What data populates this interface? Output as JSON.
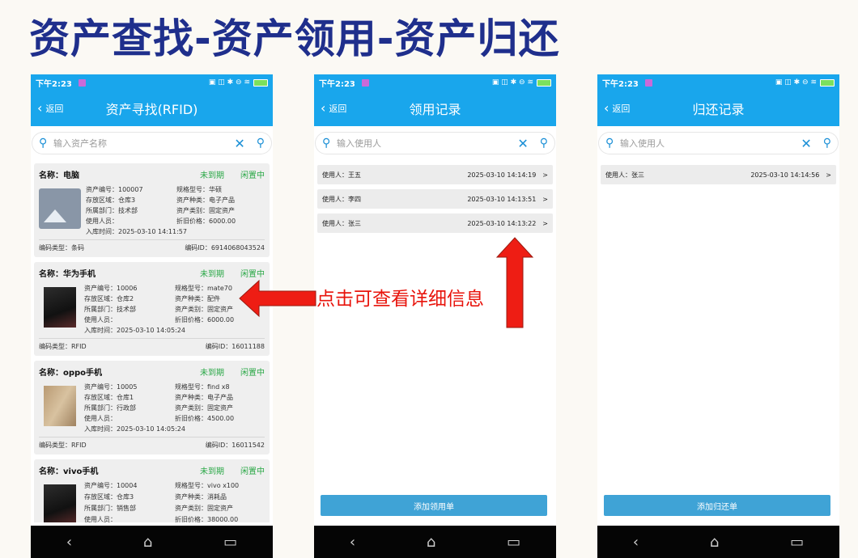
{
  "page_title": "资产查找-资产领用-资产归还",
  "annotation": "点击可查看详细信息",
  "status": {
    "time": "下午2:23"
  },
  "back_label": "返回",
  "screen1": {
    "title": "资产寻找(RFID)",
    "search_placeholder": "输入资产名称",
    "cards": [
      {
        "name": "名称：电脑",
        "status1": "未到期",
        "status2": "闲置中",
        "f1a": "资产编号：100007",
        "f1b": "规格型号：华硕",
        "f2a": "存放区域：仓库3",
        "f2b": "资产种类：电子产品",
        "f3a": "所属部门：技术部",
        "f3b": "资产类别：固定资产",
        "f4a": "使用人员：",
        "f4b": "折旧价格：6000.00",
        "f5a": "入库时间：2025-03-10 14:11:57",
        "code_type": "编码类型：条码",
        "code_id": "编码ID：6914068043524"
      },
      {
        "name": "名称：华为手机",
        "status1": "未到期",
        "status2": "闲置中",
        "f1a": "资产编号：10006",
        "f1b": "规格型号：mate70",
        "f2a": "存放区域：仓库2",
        "f2b": "资产种类：配件",
        "f3a": "所属部门：技术部",
        "f3b": "资产类别：固定资产",
        "f4a": "使用人员：",
        "f4b": "折旧价格：6000.00",
        "f5a": "入库时间：2025-03-10 14:05:24",
        "code_type": "编码类型：RFID",
        "code_id": "编码ID：16011188"
      },
      {
        "name": "名称：oppo手机",
        "status1": "未到期",
        "status2": "闲置中",
        "f1a": "资产编号：10005",
        "f1b": "规格型号：find x8",
        "f2a": "存放区域：仓库1",
        "f2b": "资产种类：电子产品",
        "f3a": "所属部门：行政部",
        "f3b": "资产类别：固定资产",
        "f4a": "使用人员：",
        "f4b": "折旧价格：4500.00",
        "f5a": "入库时间：2025-03-10 14:05:24",
        "code_type": "编码类型：RFID",
        "code_id": "编码ID：16011542"
      },
      {
        "name": "名称：vivo手机",
        "status1": "未到期",
        "status2": "闲置中",
        "f1a": "资产编号：10004",
        "f1b": "规格型号：vivo x100",
        "f2a": "存放区域：仓库3",
        "f2b": "资产种类：消耗品",
        "f3a": "所属部门：销售部",
        "f3b": "资产类别：固定资产",
        "f4a": "使用人员：",
        "f4b": "折旧价格：38000.00"
      }
    ]
  },
  "screen2": {
    "title": "领用记录",
    "search_placeholder": "输入使用人",
    "records": [
      {
        "user": "使用人：王五",
        "time": "2025-03-10 14:14:19",
        "arrow": ">"
      },
      {
        "user": "使用人：李四",
        "time": "2025-03-10 14:13:51",
        "arrow": ">"
      },
      {
        "user": "使用人：张三",
        "time": "2025-03-10 14:13:22",
        "arrow": ">"
      }
    ],
    "button": "添加领用单"
  },
  "screen3": {
    "title": "归还记录",
    "search_placeholder": "输入使用人",
    "records": [
      {
        "user": "使用人：张三",
        "time": "2025-03-10 14:14:56",
        "arrow": ">"
      }
    ],
    "button": "添加归还单"
  },
  "icons": {
    "search": "search-icon",
    "clear": "clear-icon",
    "back": "chevron-left-icon"
  },
  "colors": {
    "header": "#19a6ec",
    "title": "#1f2f8c",
    "status_green": "#28a745",
    "annotation": "#e8140c"
  }
}
